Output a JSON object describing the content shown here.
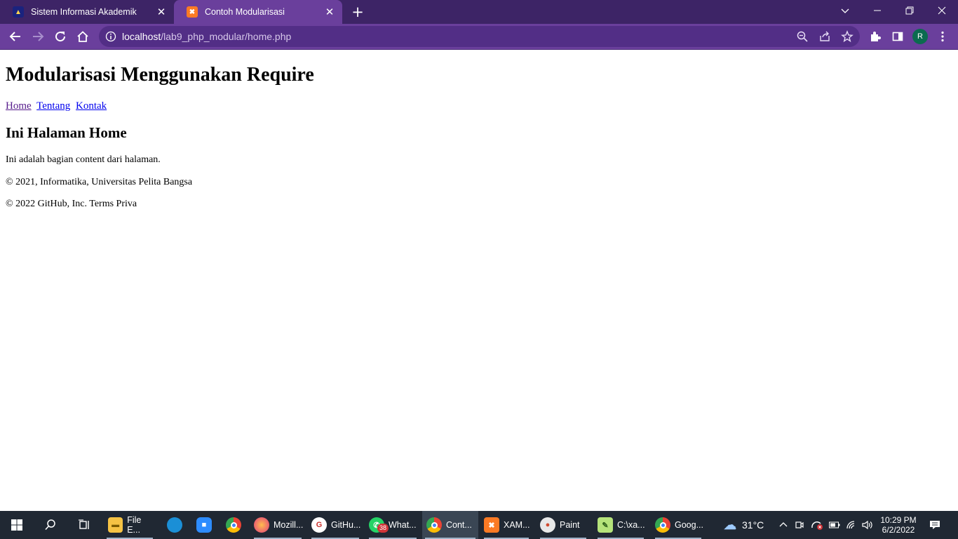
{
  "browser": {
    "tabs": [
      {
        "title": "Sistem Informasi Akademik",
        "favicon": "university-logo-icon",
        "active": false
      },
      {
        "title": "Contoh Modularisasi",
        "favicon": "xampp-icon",
        "active": true
      }
    ],
    "new_tab_label": "+",
    "url_host": "localhost",
    "url_path": "/lab9_php_modular/home.php",
    "profile_initial": "R",
    "accent_color": "#6a3f9c",
    "frame_color": "#3d2466"
  },
  "page": {
    "title": "Modularisasi Menggunakan Require",
    "nav": [
      "Home",
      "Tentang",
      "Kontak"
    ],
    "heading": "Ini Halaman Home",
    "content": "Ini adalah bagian content dari halaman.",
    "footer": "© 2021, Informatika, Universitas Pelita Bangsa",
    "extra_line": "© 2022 GitHub, Inc. Terms Priva"
  },
  "taskbar": {
    "apps": [
      {
        "label": "File E...",
        "icon": "file-explorer-icon"
      },
      {
        "label": "",
        "icon": "edge-icon"
      },
      {
        "label": "",
        "icon": "zoom-icon"
      },
      {
        "label": "",
        "icon": "chrome-icon"
      },
      {
        "label": "Mozill...",
        "icon": "firefox-icon"
      },
      {
        "label": "GitHu...",
        "icon": "github-desktop-icon"
      },
      {
        "label": "What...",
        "icon": "whatsapp-icon",
        "badge": "38"
      },
      {
        "label": "Cont...",
        "icon": "chrome-profile-icon"
      },
      {
        "label": "XAM...",
        "icon": "xampp-icon"
      },
      {
        "label": "Paint",
        "icon": "paint-icon"
      },
      {
        "label": "C:\\xa...",
        "icon": "notepad-plus-icon"
      },
      {
        "label": "Goog...",
        "icon": "chrome-icon"
      }
    ],
    "weather": "31°C",
    "time": "10:29 PM",
    "date": "6/2/2022"
  }
}
